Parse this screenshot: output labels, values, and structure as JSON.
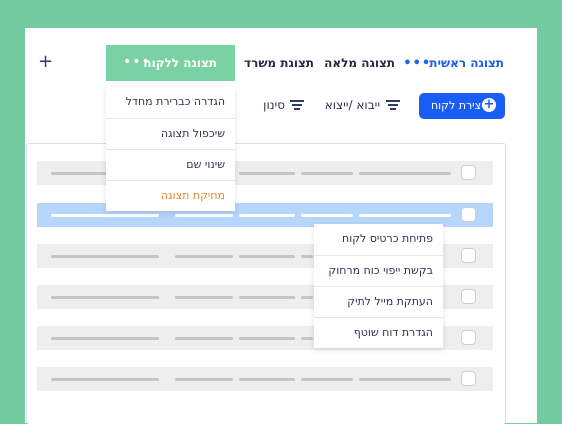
{
  "tabs": [
    {
      "label": "תצוגה ראשית"
    },
    {
      "label": "תצוגה מלאה"
    },
    {
      "label": "תצוגת משרד"
    },
    {
      "label": "תצוגה ללקוח"
    }
  ],
  "add_tab_label": "+",
  "toolbar": {
    "create_label": "יצירת לקוח",
    "import_export_label": "ייבוא /ייצוא",
    "filter_label": "סינון"
  },
  "view_menu": {
    "items": [
      "הגדרה כברירת מחדל",
      "שיכפול תצוגה",
      "שינוי שם",
      "מחיקת תצוגה"
    ]
  },
  "row_menu": {
    "items": [
      "פתיחת כרטיס לקוח",
      "בקשת ייפוי כוח מרחוק",
      "העתקת מייל לתיק",
      "הגדרת דוח שוטף"
    ]
  },
  "colors": {
    "accent": "#1a5df5",
    "active_tab": "#7ad2a4",
    "selected_row": "#b7d6fb",
    "danger_item": "#e08a33"
  }
}
